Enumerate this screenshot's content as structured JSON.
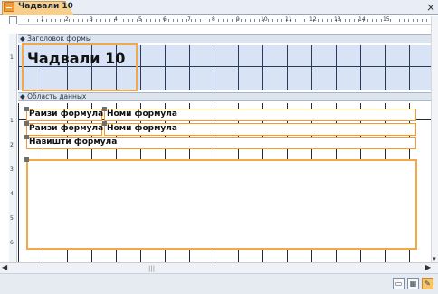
{
  "tab": {
    "title": "Чадвали 10"
  },
  "ruler": {
    "numbers": [
      "1",
      "2",
      "3",
      "4",
      "5",
      "6",
      "7",
      "8",
      "9",
      "10",
      "11",
      "12",
      "13",
      "14",
      "15"
    ]
  },
  "vruler_header": [
    "1"
  ],
  "vruler_detail": [
    "1",
    "2",
    "3",
    "4",
    "5",
    "6"
  ],
  "sections": {
    "header": {
      "label": "Заголовок формы"
    },
    "detail": {
      "label": "Область данных"
    }
  },
  "header": {
    "title": "Чадвали 10"
  },
  "detail": {
    "row1": {
      "label1": "Рамзи формула",
      "label2": "Номи формула"
    },
    "row2": {
      "label1": "Рамзи формула",
      "label2": "Номи формула"
    },
    "row3": {
      "label1": "Навишти формула"
    }
  },
  "statusbar": {
    "views": [
      "form-view-icon",
      "datasheet-view-icon",
      "design-view-icon"
    ]
  }
}
